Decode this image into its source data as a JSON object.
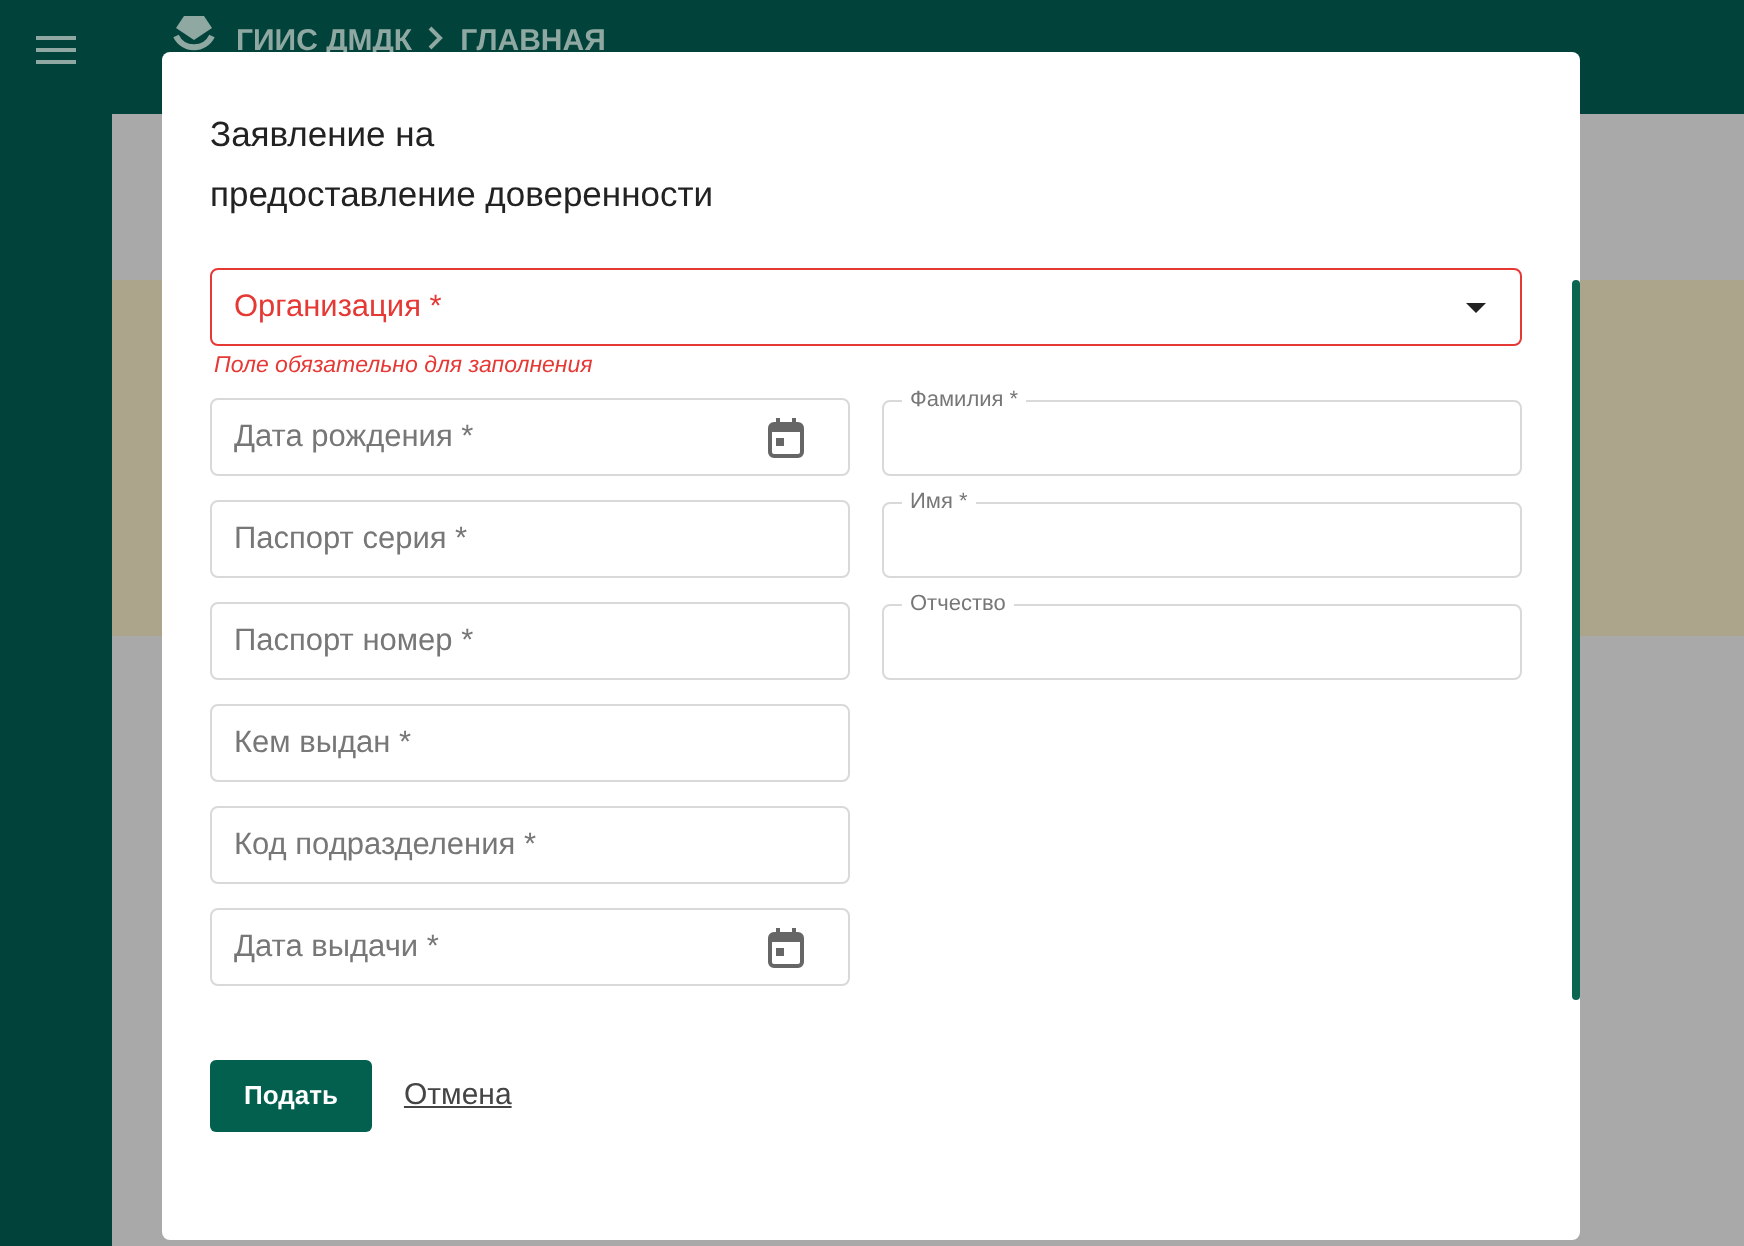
{
  "header": {
    "breadcrumb": [
      "ГИИС ДМДК",
      "ГЛАВНАЯ"
    ]
  },
  "dialog": {
    "title": "Заявление на\nпредоставление доверенности",
    "organization": {
      "placeholder": "Организация *",
      "invalid": true,
      "error": "Поле обязательно для заполнения"
    },
    "left_fields": [
      {
        "placeholder": "Дата рождения *",
        "kind": "date"
      },
      {
        "placeholder": "Паспорт серия *",
        "kind": "text"
      },
      {
        "placeholder": "Паспорт номер *",
        "kind": "text"
      },
      {
        "placeholder": "Кем выдан *",
        "kind": "text"
      },
      {
        "placeholder": "Код подразделения *",
        "kind": "text"
      },
      {
        "placeholder": "Дата выдачи *",
        "kind": "date"
      }
    ],
    "right_fields": [
      {
        "label": "Фамилия *"
      },
      {
        "label": "Имя *"
      },
      {
        "label": "Отчество"
      }
    ],
    "submit": "Подать",
    "cancel": "Отмена"
  }
}
